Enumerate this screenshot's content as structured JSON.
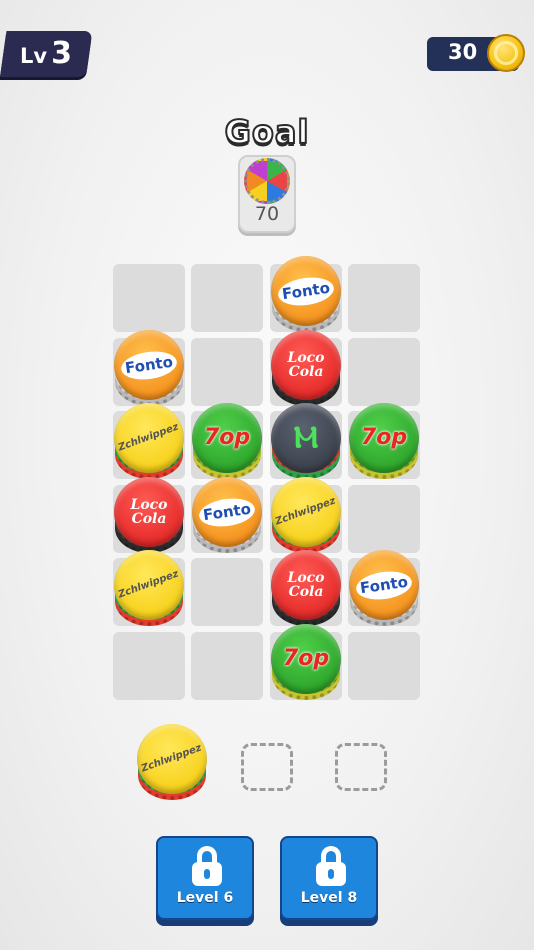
{
  "hud": {
    "level_label": "Lv",
    "level_number": "3",
    "coins": "30"
  },
  "goal": {
    "title": "Goal",
    "target": "70",
    "icon": "multicolor-cap-icon"
  },
  "board": {
    "rows": 6,
    "cols": 4,
    "caps": [
      {
        "row": 0,
        "col": 2,
        "brand": "Fonto",
        "kind": "fonto"
      },
      {
        "row": 1,
        "col": 0,
        "brand": "Fonto",
        "kind": "fonto"
      },
      {
        "row": 1,
        "col": 2,
        "brand": "Loco Cola",
        "kind": "loco"
      },
      {
        "row": 2,
        "col": 0,
        "brand": "Zchlwippez",
        "kind": "zch"
      },
      {
        "row": 2,
        "col": 1,
        "brand": "7op",
        "kind": "sevenup"
      },
      {
        "row": 2,
        "col": 2,
        "brand": "",
        "kind": "monster"
      },
      {
        "row": 2,
        "col": 3,
        "brand": "7op",
        "kind": "sevenup"
      },
      {
        "row": 3,
        "col": 0,
        "brand": "Loco Cola",
        "kind": "loco"
      },
      {
        "row": 3,
        "col": 1,
        "brand": "Fonto",
        "kind": "fonto"
      },
      {
        "row": 3,
        "col": 2,
        "brand": "Zchlwippez",
        "kind": "zch"
      },
      {
        "row": 4,
        "col": 0,
        "brand": "Zchlwippez",
        "kind": "zch"
      },
      {
        "row": 4,
        "col": 2,
        "brand": "Loco Cola",
        "kind": "loco"
      },
      {
        "row": 4,
        "col": 3,
        "brand": "Fonto",
        "kind": "fonto"
      },
      {
        "row": 5,
        "col": 2,
        "brand": "7op",
        "kind": "sevenup"
      }
    ]
  },
  "holder": {
    "cap": {
      "brand": "Zchlwippez",
      "kind": "zch"
    },
    "empty_slots": 2
  },
  "locked_slots": [
    {
      "label": "Level 6",
      "icon": "lock-icon"
    },
    {
      "label": "Level 8",
      "icon": "lock-icon"
    }
  ],
  "colors": {
    "hud_bg": "#2b2b52",
    "coin_gold": "#f7c51a",
    "button_blue": "#1e86dd",
    "cell_gray": "#dcdcdc"
  }
}
